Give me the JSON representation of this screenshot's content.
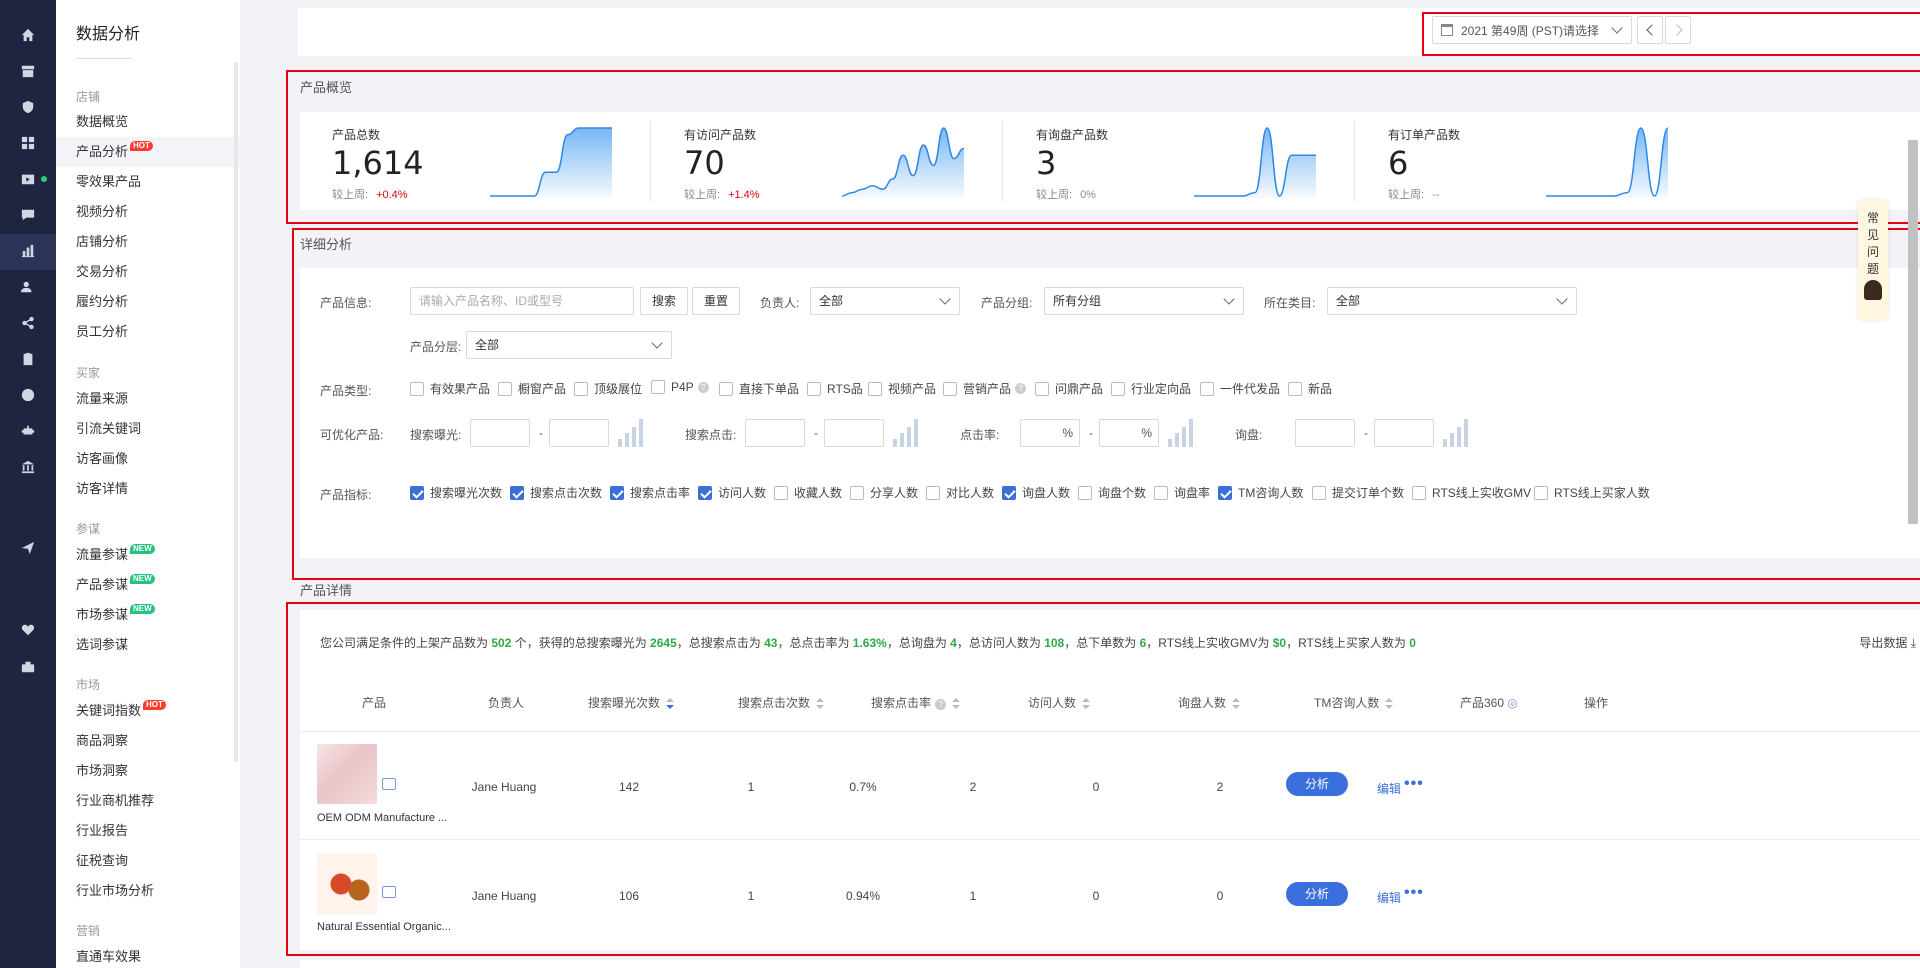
{
  "colors": {
    "rail": "#1f2540",
    "accent": "#3a6fd8",
    "alert_box": "#e60012",
    "positive": "#2eaa44",
    "hot": "#ff3b30",
    "new": "#26c281"
  },
  "rail_icons": [
    "home-icon",
    "store-icon",
    "shield-icon",
    "grid-icon",
    "video-icon",
    "chat-icon",
    "bar-chart-icon",
    "users-icon",
    "share-icon",
    "clipboard-icon",
    "globe-icon",
    "robot-icon",
    "bank-icon",
    "send-icon",
    "heart-icon",
    "briefcase-icon"
  ],
  "subnav": {
    "title": "数据分析",
    "groups": [
      {
        "name": "店铺",
        "items": [
          {
            "label": "数据概览"
          },
          {
            "label": "产品分析",
            "badge": "HOT",
            "selected": true
          },
          {
            "label": "零效果产品"
          },
          {
            "label": "视频分析"
          },
          {
            "label": "店铺分析"
          },
          {
            "label": "交易分析"
          },
          {
            "label": "履约分析"
          },
          {
            "label": "员工分析"
          }
        ]
      },
      {
        "name": "买家",
        "items": [
          {
            "label": "流量来源"
          },
          {
            "label": "引流关键词"
          },
          {
            "label": "访客画像"
          },
          {
            "label": "访客详情"
          }
        ]
      },
      {
        "name": "参谋",
        "items": [
          {
            "label": "流量参谋",
            "badge": "NEW"
          },
          {
            "label": "产品参谋",
            "badge": "NEW"
          },
          {
            "label": "市场参谋",
            "badge": "NEW"
          },
          {
            "label": "选词参谋"
          }
        ]
      },
      {
        "name": "市场",
        "items": [
          {
            "label": "关键词指数",
            "badge": "HOT"
          },
          {
            "label": "商品洞察"
          },
          {
            "label": "市场洞察"
          },
          {
            "label": "行业商机推荐"
          },
          {
            "label": "行业报告"
          },
          {
            "label": "征税查询"
          },
          {
            "label": "行业市场分析"
          }
        ]
      },
      {
        "name": "营销",
        "items": [
          {
            "label": "直通车效果"
          }
        ]
      }
    ]
  },
  "week_picker": {
    "value": "2021 第49周 (PST)请选择"
  },
  "overview": {
    "title": "产品概览",
    "compare_label": "较上周:",
    "kpis": [
      {
        "label": "产品总数",
        "value": "1,614",
        "change": "+0.4%",
        "sparkline": [
          0,
          0,
          0,
          0,
          0,
          0.35,
          0.35,
          0.9,
          1,
          1,
          1,
          1
        ]
      },
      {
        "label": "有访问产品数",
        "value": "70",
        "change": "+1.4%",
        "sparkline": [
          0,
          0.05,
          0.1,
          0.15,
          0.1,
          0.25,
          0.6,
          0.3,
          0.75,
          0.45,
          1,
          0.55,
          0.7
        ]
      },
      {
        "label": "有询盘产品数",
        "value": "3",
        "change": "0%",
        "sparkline": [
          0,
          0,
          0,
          0,
          0,
          0.05,
          1,
          0,
          0.6,
          0.6,
          0.6
        ]
      },
      {
        "label": "有订单产品数",
        "value": "6",
        "change": "--",
        "sparkline": [
          0,
          0,
          0,
          0,
          0,
          0,
          0.05,
          1,
          0,
          1
        ]
      }
    ]
  },
  "detail": {
    "title": "详细分析",
    "product_info_label": "产品信息:",
    "search_placeholder": "请输入产品名称、ID或型号",
    "search_button": "搜索",
    "reset_button": "重置",
    "owner_label": "负责人:",
    "owner_value": "全部",
    "group_label": "产品分组:",
    "group_value": "所有分组",
    "category_label": "所在类目:",
    "category_value": "全部",
    "tier_label": "产品分层:",
    "tier_value": "全部",
    "type_label": "产品类型:",
    "types": [
      "有效果产品",
      "橱窗产品",
      "顶级展位",
      "P4P",
      "直接下单品",
      "RTS品",
      "视频产品",
      "营销产品",
      "问鼎产品",
      "行业定向品",
      "一件代发品",
      "新品"
    ],
    "optimizable_label": "可优化产品:",
    "ranges": [
      {
        "label": "搜索曝光:"
      },
      {
        "label": "搜索点击:"
      },
      {
        "label": "点击率:",
        "unit": "%"
      },
      {
        "label": "询盘:"
      }
    ],
    "range_sep": "-",
    "metrics_label": "产品指标:",
    "metrics": [
      {
        "label": "搜索曝光次数",
        "checked": true
      },
      {
        "label": "搜索点击次数",
        "checked": true
      },
      {
        "label": "搜索点击率",
        "checked": true
      },
      {
        "label": "访问人数",
        "checked": true
      },
      {
        "label": "收藏人数",
        "checked": false
      },
      {
        "label": "分享人数",
        "checked": false
      },
      {
        "label": "对比人数",
        "checked": false
      },
      {
        "label": "询盘人数",
        "checked": true
      },
      {
        "label": "询盘个数",
        "checked": false
      },
      {
        "label": "询盘率",
        "checked": false
      },
      {
        "label": "TM咨询人数",
        "checked": true
      },
      {
        "label": "提交订单个数",
        "checked": false
      },
      {
        "label": "RTS线上实收GMV",
        "checked": false
      },
      {
        "label": "RTS线上买家人数",
        "checked": false
      }
    ]
  },
  "product_detail": {
    "title": "产品详情",
    "summary": {
      "p1": "您公司满足条件的上架产品数为 ",
      "v1": "502",
      "p2": " 个，获得的总搜索曝光为 ",
      "v2": "2645",
      "p3": "，总搜索点击为 ",
      "v3": "43",
      "p4": "，总点击率为 ",
      "v4": "1.63%",
      "p5": "，总询盘为 ",
      "v5": "4",
      "p6": "，总访问人数为 ",
      "v6": "108",
      "p7": "，总下单数为 ",
      "v7": "6",
      "p8": "，RTS线上实收GMV为 ",
      "v8": "$0",
      "p9": "，RTS线上买家人数为 ",
      "v9": "0"
    },
    "export_label": "导出数据",
    "columns": [
      "产品",
      "负责人",
      "搜索曝光次数",
      "搜索点击次数",
      "搜索点击率",
      "访问人数",
      "询盘人数",
      "TM咨询人数",
      "产品360",
      "操作"
    ],
    "rows": [
      {
        "name": "OEM ODM Manufacture ...",
        "owner": "Jane Huang",
        "impressions": "142",
        "clicks": "1",
        "ctr": "0.7%",
        "visitors": "2",
        "inquirers": "0",
        "tm": "2"
      },
      {
        "name": "Natural Essential Organic...",
        "owner": "Jane Huang",
        "impressions": "106",
        "clicks": "1",
        "ctr": "0.94%",
        "visitors": "1",
        "inquirers": "0",
        "tm": "0"
      }
    ],
    "analyze_label": "分析",
    "edit_label": "编辑",
    "more_label": "•••"
  },
  "faq": {
    "label": "常见问题"
  }
}
